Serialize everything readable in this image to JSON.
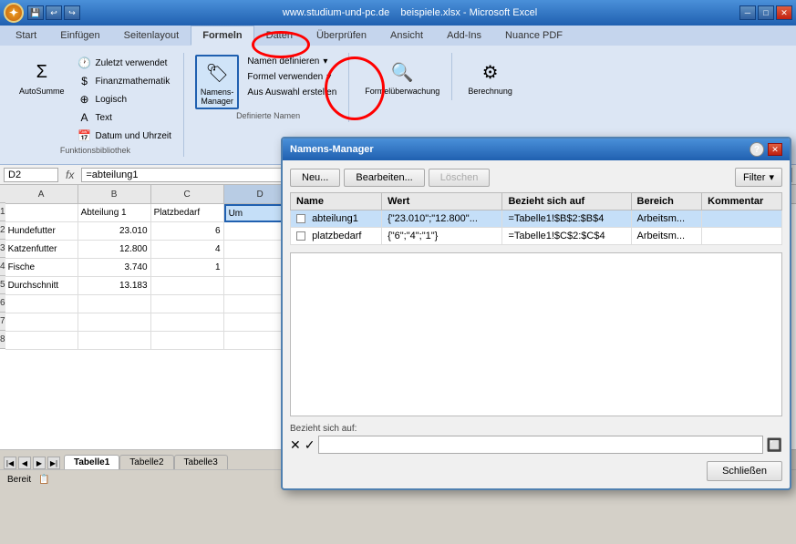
{
  "titlebar": {
    "url": "www.studium-und-pc.de",
    "filename": "beispiele.xlsx",
    "app": "Microsoft Excel",
    "minimize": "─",
    "maximize": "□",
    "close": "✕"
  },
  "ribbon": {
    "tabs": [
      "Start",
      "Einfügen",
      "Seitenlayout",
      "Formeln",
      "Daten",
      "Überprüfen",
      "Ansicht",
      "Add-Ins",
      "Nuance PDF"
    ],
    "active_tab": "Formeln",
    "groups": [
      {
        "name": "Funktionsbibliothek",
        "buttons": [
          "AutoSumme",
          "Zuletzt verwendet",
          "Finanzmathematik",
          "Logisch",
          "Text",
          "Datum und Uhrzeit"
        ]
      },
      {
        "name": "Definierte Namen",
        "buttons": [
          "Namens-Manager",
          "Namen definieren",
          "Formel verwenden",
          "Aus Auswahl erstellen"
        ]
      },
      {
        "name": "Formelüberwachung",
        "label": "Formelüberwachung"
      },
      {
        "name": "Berechnung",
        "label": "Berechnung"
      }
    ]
  },
  "formula_bar": {
    "cell_ref": "D2",
    "formula": "=abteilung1"
  },
  "spreadsheet": {
    "col_headers": [
      "A",
      "B",
      "C",
      "D"
    ],
    "rows": [
      [
        "",
        "Abteilung 1",
        "Platzbedarf",
        "Um"
      ],
      [
        "Hundefutter",
        "23.010",
        "6",
        ""
      ],
      [
        "Katzenfutter",
        "12.800",
        "4",
        ""
      ],
      [
        "Fische",
        "3.740",
        "1",
        ""
      ],
      [
        "Durchschnitt",
        "13.183",
        "",
        ""
      ],
      [
        "",
        "",
        "",
        ""
      ],
      [
        "",
        "",
        "",
        ""
      ],
      [
        "",
        "",
        "",
        ""
      ]
    ],
    "selected_cell": "D2"
  },
  "sheet_tabs": [
    "Tabelle1",
    "Tabelle2",
    "Tabelle3"
  ],
  "active_sheet": "Tabelle1",
  "status": "Bereit",
  "dialog": {
    "title": "Namens-Manager",
    "buttons": {
      "new": "Neu...",
      "edit": "Bearbeiten...",
      "delete": "Löschen",
      "filter": "Filter",
      "close": "Schließen"
    },
    "table_headers": [
      "Name",
      "Wert",
      "Bezieht sich auf",
      "Bereich",
      "Kommentar"
    ],
    "rows": [
      {
        "name": "abteilung1",
        "value": "{\"23.010\";\"12.800\"...",
        "refers_to": "=Tabelle1!$B$2:$B$4",
        "scope": "Arbeitsm...",
        "comment": ""
      },
      {
        "name": "platzbedarf",
        "value": "{\"6\";\"4\";\"1\"}",
        "refers_to": "=Tabelle1!$C$2:$C$4",
        "scope": "Arbeitsm...",
        "comment": ""
      }
    ],
    "refers_to_label": "Bezieht sich auf:",
    "refers_to_value": "",
    "help_tooltip": "?"
  },
  "annotations": {
    "circle1": {
      "desc": "Formeln tab circle"
    },
    "circle2": {
      "desc": "Namens-Manager button circle"
    }
  }
}
